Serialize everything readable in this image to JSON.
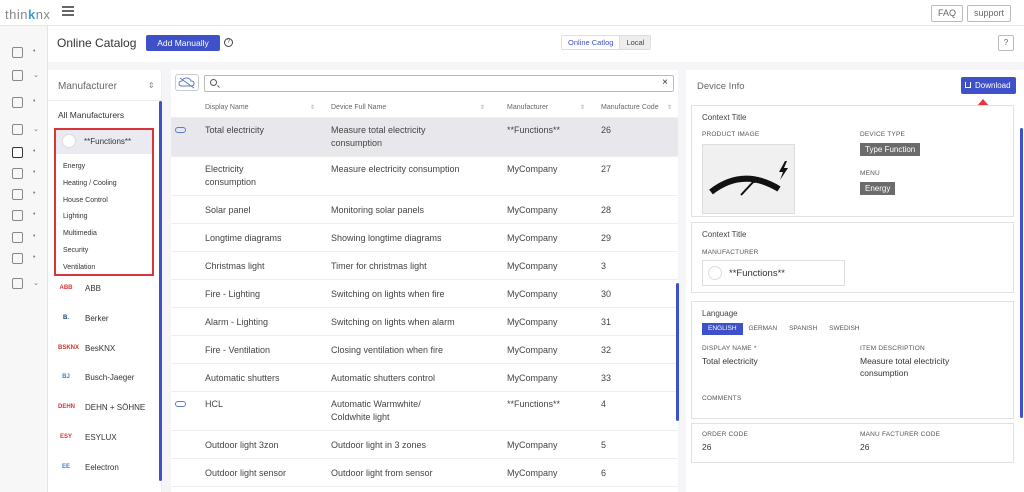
{
  "app": {
    "logo_prefix": "thin",
    "logo_accent": "k",
    "logo_suffix": "nx"
  },
  "topbar": {
    "faq_label": "FAQ",
    "support_label": "support"
  },
  "header": {
    "title": "Online Catalog",
    "add_button": "Add Manually",
    "help": "?",
    "tabs": [
      "Online Catlog",
      "Local"
    ],
    "q_button": "?"
  },
  "rail": {
    "items": [
      "images-icon",
      "user-icon",
      "checklist-icon",
      "link-icon",
      "catalog-icon",
      "document-icon",
      "users-icon",
      "gear-icon",
      "list-icon",
      "people-icon",
      "menu-icon"
    ]
  },
  "manufacturer": {
    "heading": "Manufacturer",
    "all_label": "All Manufacturers",
    "selected": {
      "name": "**Functions**",
      "subs": [
        "Energy",
        "Heating / Cooling",
        "House Control",
        "Lighting",
        "Multimedia",
        "Security",
        "Ventilation"
      ]
    },
    "items": [
      {
        "name": "ABB",
        "logo": "ABB",
        "color": "#d9343a"
      },
      {
        "name": "Berker",
        "logo": "B.",
        "color": "#1b3f7a"
      },
      {
        "name": "BesKNX",
        "logo": "BSKNX",
        "color": "#c0392b"
      },
      {
        "name": "Busch-Jaeger",
        "logo": "BJ",
        "color": "#3a7bd5"
      },
      {
        "name": "DEHN + SÖHNE",
        "logo": "DEHN",
        "color": "#d9343a"
      },
      {
        "name": "ESYLUX",
        "logo": "ESY",
        "color": "#d9343a"
      },
      {
        "name": "Eelectron",
        "logo": "EE",
        "color": "#3a7bd5"
      }
    ]
  },
  "table": {
    "search_value": "",
    "search_placeholder": "",
    "clear": "×",
    "columns": [
      "Display Name",
      "Device Full Name",
      "Manufacturer",
      "Manufacture Code"
    ],
    "rows": [
      {
        "display": [
          "Total electricity"
        ],
        "full": [
          "Measure total electricity",
          "consumption"
        ],
        "manufacturer": "**Functions**",
        "code": "26",
        "cloud": true,
        "selected": true
      },
      {
        "display": [
          "Electricity",
          "consumption"
        ],
        "full": [
          "Measure electricity consumption"
        ],
        "manufacturer": "MyCompany",
        "code": "27",
        "cloud": false,
        "selected": false
      },
      {
        "display": [
          "Solar panel"
        ],
        "full": [
          "Monitoring solar panels"
        ],
        "manufacturer": "MyCompany",
        "code": "28",
        "cloud": false,
        "selected": false
      },
      {
        "display": [
          "Longtime diagrams"
        ],
        "full": [
          "Showing longtime diagrams"
        ],
        "manufacturer": "MyCompany",
        "code": "29",
        "cloud": false,
        "selected": false
      },
      {
        "display": [
          "Christmas light"
        ],
        "full": [
          "Timer for christmas light"
        ],
        "manufacturer": "MyCompany",
        "code": "3",
        "cloud": false,
        "selected": false
      },
      {
        "display": [
          "Fire - Lighting"
        ],
        "full": [
          "Switching on lights when fire"
        ],
        "manufacturer": "MyCompany",
        "code": "30",
        "cloud": false,
        "selected": false
      },
      {
        "display": [
          "Alarm - Lighting"
        ],
        "full": [
          "Switching on lights when alarm"
        ],
        "manufacturer": "MyCompany",
        "code": "31",
        "cloud": false,
        "selected": false
      },
      {
        "display": [
          "Fire - Ventilation"
        ],
        "full": [
          "Closing ventilation when fire"
        ],
        "manufacturer": "MyCompany",
        "code": "32",
        "cloud": false,
        "selected": false
      },
      {
        "display": [
          "Automatic shutters"
        ],
        "full": [
          "Automatic shutters control"
        ],
        "manufacturer": "MyCompany",
        "code": "33",
        "cloud": false,
        "selected": false
      },
      {
        "display": [
          "HCL"
        ],
        "full": [
          "Automatic Warmwhite/",
          "Coldwhite light"
        ],
        "manufacturer": "**Functions**",
        "code": "4",
        "cloud": true,
        "selected": false
      },
      {
        "display": [
          "Outdoor light 3zon"
        ],
        "full": [
          "Outdoor light in 3 zones"
        ],
        "manufacturer": "MyCompany",
        "code": "5",
        "cloud": false,
        "selected": false
      },
      {
        "display": [
          "Outdoor light sensor"
        ],
        "full": [
          "Outdoor light from sensor"
        ],
        "manufacturer": "MyCompany",
        "code": "6",
        "cloud": false,
        "selected": false
      }
    ]
  },
  "info": {
    "title": "Device Info",
    "download": "Download",
    "card1": {
      "title": "Context Title",
      "image_label": "PRODUCT IMAGE",
      "device_type_label": "DEVICE TYPE",
      "device_type": "Type Function",
      "menu_label": "MENU",
      "menu": "Energy"
    },
    "card2": {
      "title": "Context Title",
      "manufacturer_label": "MANUFACTURER",
      "manufacturer": "**Functions**"
    },
    "card3": {
      "title": "Language",
      "languages": [
        "ENGLISH",
        "GERMAN",
        "SPANISH",
        "SWEDISH"
      ],
      "display_name_label": "DISPLAY NAME *",
      "display_name": "Total electricity",
      "item_desc_label": "ITEM DESCRIPTION",
      "item_desc": [
        "Measure total electricity",
        "consumption"
      ],
      "comments_label": "COMMENTS"
    },
    "card4": {
      "order_code_label": "ORDER CODE",
      "order_code": "26",
      "manu_code_label": "MANU FACTURER CODE",
      "manu_code": "26"
    }
  },
  "colors": {
    "accent": "#3f51c8",
    "highlight": "#d9343a"
  }
}
